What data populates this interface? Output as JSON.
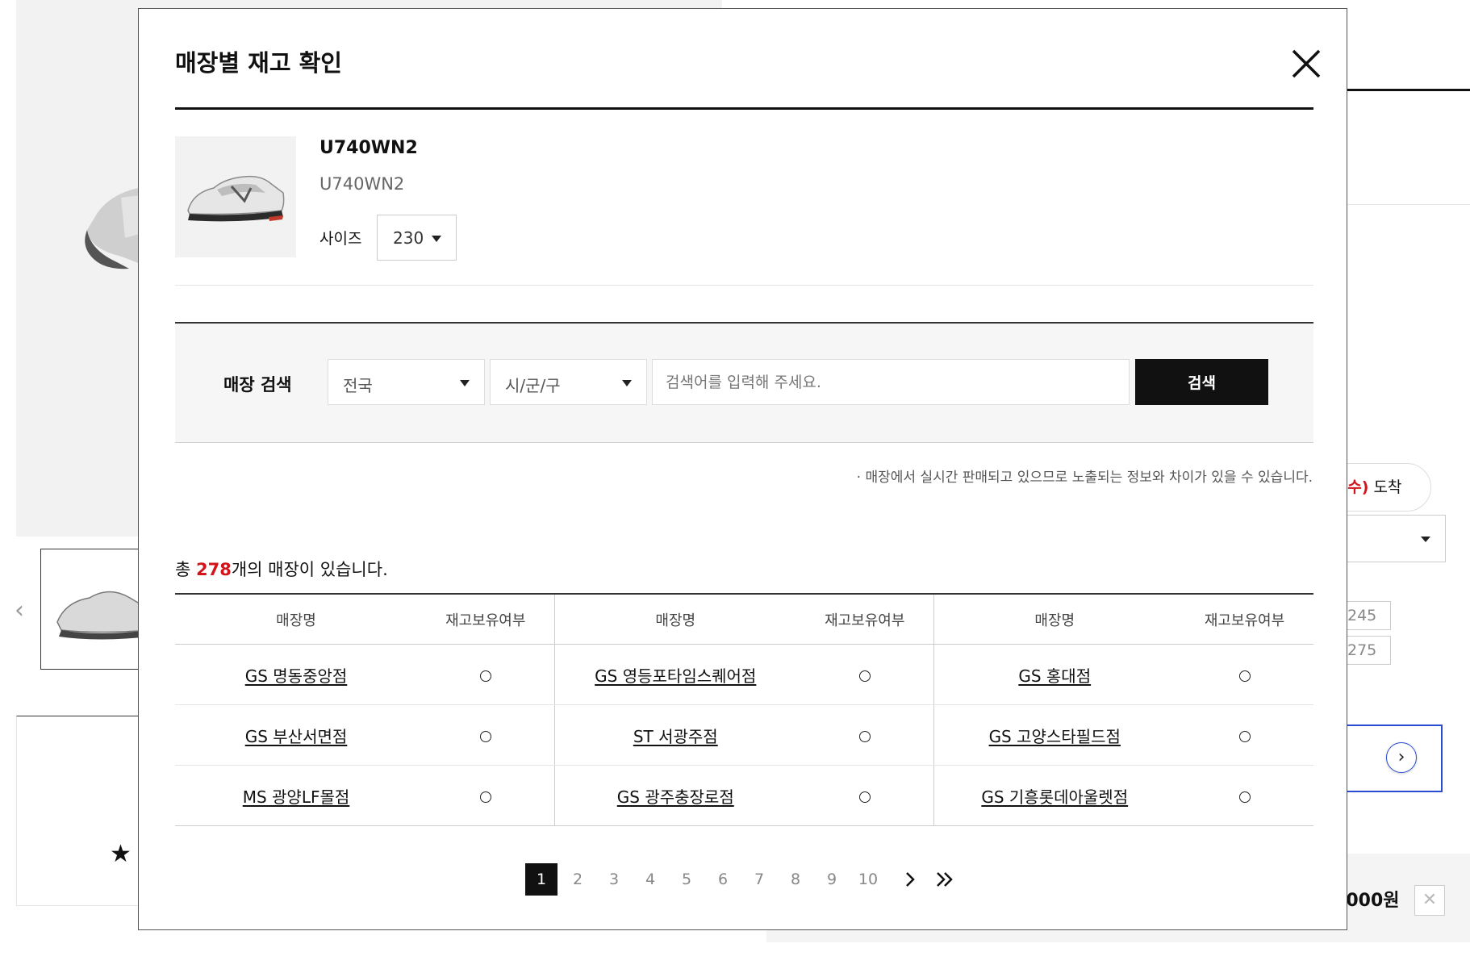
{
  "background": {
    "delivery_suffix": ".수)",
    "delivery_label": "도착",
    "size_chips": [
      "245",
      "275"
    ],
    "price_text": ",000원"
  },
  "modal": {
    "title": "매장별 재고 확인",
    "close_icon": "close-icon"
  },
  "product": {
    "name": "U740WN2",
    "code": "U740WN2",
    "size_label": "사이즈",
    "size_value": "230"
  },
  "search": {
    "label": "매장 검색",
    "region_value": "전국",
    "district_value": "시/군/구",
    "input_placeholder": "검색어를 입력해 주세요.",
    "button_label": "검색"
  },
  "notice": "· 매장에서 실시간 판매되고 있으므로 노출되는 정보와 차이가 있을 수 있습니다.",
  "summary": {
    "prefix": "총 ",
    "count": "278",
    "suffix": "개의 매장이 있습니다."
  },
  "table": {
    "headers": [
      "매장명",
      "재고보유여부",
      "매장명",
      "재고보유여부",
      "매장명",
      "재고보유여부"
    ],
    "rows": [
      [
        {
          "store": "GS 명동중앙점",
          "stock": "O"
        },
        {
          "store": "GS 영등포타임스퀘어점",
          "stock": "O"
        },
        {
          "store": "GS 홍대점",
          "stock": "O"
        }
      ],
      [
        {
          "store": "GS 부산서면점",
          "stock": "O"
        },
        {
          "store": "ST 서광주점",
          "stock": "O"
        },
        {
          "store": "GS 고양스타필드점",
          "stock": "O"
        }
      ],
      [
        {
          "store": "MS 광양LF몰점",
          "stock": "O"
        },
        {
          "store": "GS 광주충장로점",
          "stock": "O"
        },
        {
          "store": "GS 기흥롯데아울렛점",
          "stock": "O"
        }
      ]
    ]
  },
  "pagination": {
    "pages": [
      "1",
      "2",
      "3",
      "4",
      "5",
      "6",
      "7",
      "8",
      "9",
      "10"
    ],
    "current": "1",
    "next_icon": "chevron-right-icon",
    "last_icon": "double-chevron-right-icon"
  },
  "colors": {
    "accent_red": "#d3141c",
    "dark": "#111111",
    "search_bg": "#f6f6f6",
    "bg_blue": "#2a4cd0"
  }
}
